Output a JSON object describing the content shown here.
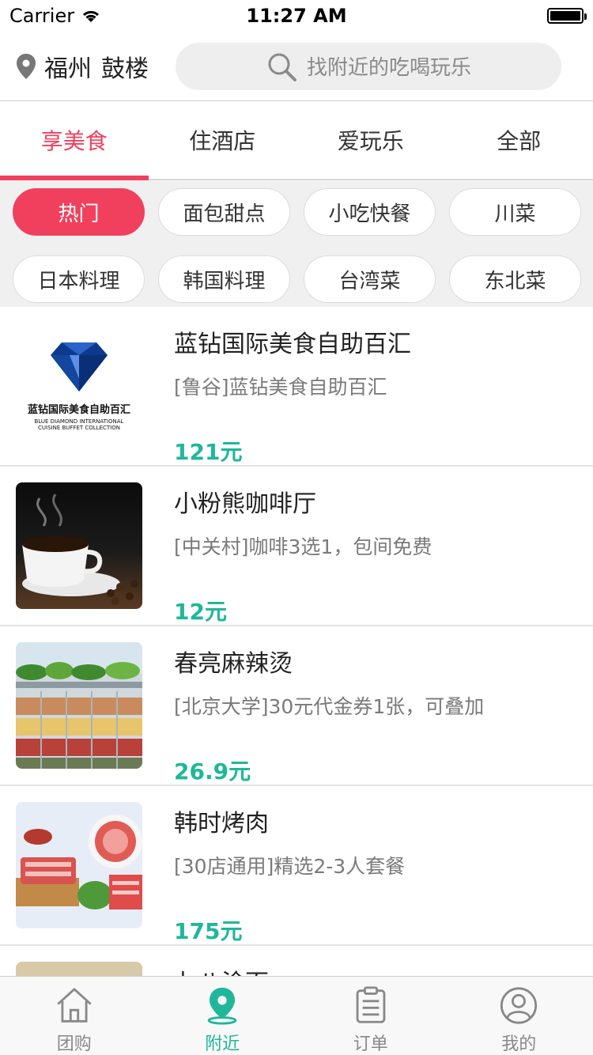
{
  "status_bar": {
    "carrier": "Carrier",
    "time": "11:27 AM"
  },
  "header": {
    "city": "福州",
    "district": "鼓楼",
    "search_placeholder": "找附近的吃喝玩乐"
  },
  "tabs": [
    {
      "label": "享美食",
      "active": true
    },
    {
      "label": "住酒店",
      "active": false
    },
    {
      "label": "爱玩乐",
      "active": false
    },
    {
      "label": "全部",
      "active": false
    }
  ],
  "chips": [
    {
      "label": "热门",
      "active": true
    },
    {
      "label": "面包甜点"
    },
    {
      "label": "小吃快餐"
    },
    {
      "label": "川菜"
    },
    {
      "label": "日本料理"
    },
    {
      "label": "韩国料理"
    },
    {
      "label": "台湾菜"
    },
    {
      "label": "东北菜"
    }
  ],
  "deals": [
    {
      "title": "蓝钻国际美食自助百汇",
      "desc": "[鲁谷]蓝钻美食自助百汇",
      "price": "121元",
      "logo_title": "蓝钻国际美食自助百汇",
      "logo_sub1": "BLUE DIAMOND INTERNATIONAL",
      "logo_sub2": "CUISINE BUFFET COLLECTION"
    },
    {
      "title": "小粉熊咖啡厅",
      "desc": "[中关村]咖啡3选1，包间免费",
      "price": "12元"
    },
    {
      "title": "春亮麻辣烫",
      "desc": "[北京大学]30元代金券1张，可叠加",
      "price": "26.9元"
    },
    {
      "title": "韩时烤肉",
      "desc": "[30店通用]精选2-3人套餐",
      "price": "175元"
    },
    {
      "title": "七八涂面",
      "desc": "",
      "price": ""
    }
  ],
  "tabbar": [
    {
      "label": "团购",
      "icon": "house-icon",
      "active": false
    },
    {
      "label": "附近",
      "icon": "location-pin-icon",
      "active": true
    },
    {
      "label": "订单",
      "icon": "order-list-icon",
      "active": false
    },
    {
      "label": "我的",
      "icon": "user-icon",
      "active": false
    }
  ],
  "colors": {
    "accent": "#f0405e",
    "price": "#1fb79a"
  }
}
